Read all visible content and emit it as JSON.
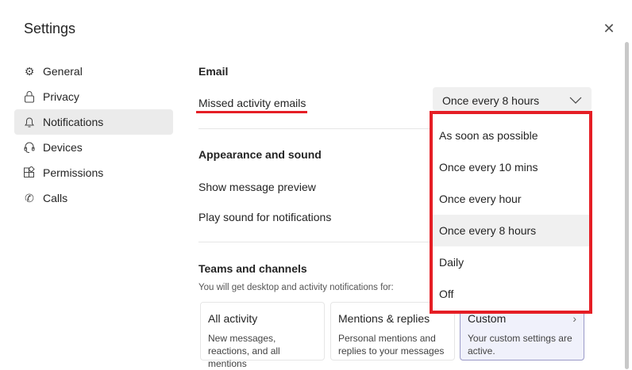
{
  "title": "Settings",
  "nav": [
    {
      "label": "General",
      "icon": "gear-icon"
    },
    {
      "label": "Privacy",
      "icon": "lock-icon"
    },
    {
      "label": "Notifications",
      "icon": "bell-icon"
    },
    {
      "label": "Devices",
      "icon": "headset-icon"
    },
    {
      "label": "Permissions",
      "icon": "apps-icon"
    },
    {
      "label": "Calls",
      "icon": "phone-icon"
    }
  ],
  "email": {
    "heading": "Email",
    "missed_label": "Missed activity emails",
    "selected": "Once every 8 hours",
    "options": [
      "As soon as possible",
      "Once every 10 mins",
      "Once every hour",
      "Once every 8 hours",
      "Daily",
      "Off"
    ]
  },
  "appearance": {
    "heading": "Appearance and sound",
    "preview": "Show message preview",
    "sound": "Play sound for notifications"
  },
  "teams": {
    "heading": "Teams and channels",
    "sub": "You will get desktop and activity notifications for:",
    "cards": [
      {
        "title": "All activity",
        "desc": "New messages, reactions, and all mentions"
      },
      {
        "title": "Mentions & replies",
        "desc": "Personal mentions and replies to your messages"
      },
      {
        "title": "Custom",
        "desc": "Your custom settings are active."
      }
    ]
  },
  "colors": {
    "highlight": "#e51e25"
  }
}
